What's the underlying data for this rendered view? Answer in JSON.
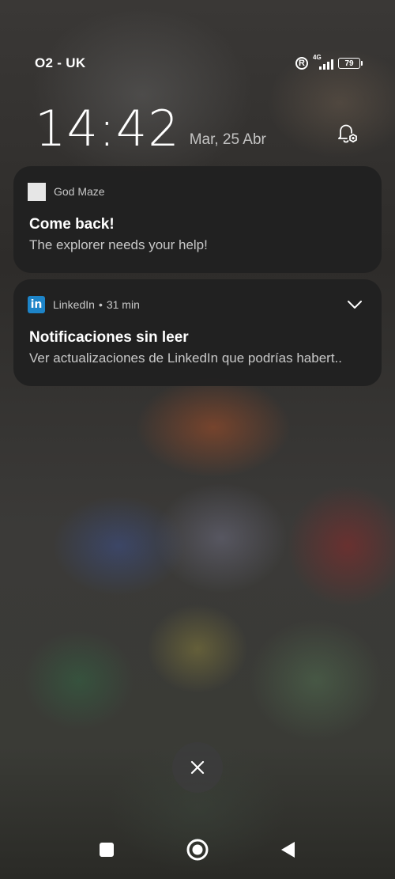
{
  "status_bar": {
    "carrier": "O2 - UK",
    "roaming_letter": "R",
    "network_type": "4G",
    "battery_level": "79",
    "signal_icon": "signal-bars-icon"
  },
  "lockscreen": {
    "time": "14:42",
    "date": "Mar, 25 Abr",
    "bell_icon": "notification-settings-icon"
  },
  "notifications": [
    {
      "app_name": "God Maze",
      "title": "Come back!",
      "body": "The explorer needs your help!",
      "icon": "blank-app-icon"
    },
    {
      "app_name": "LinkedIn",
      "icon_text": "in",
      "time_ago": "31 min",
      "title": "Notificaciones sin leer",
      "body": "Ver actualizaciones de LinkedIn que podrías habert..",
      "icon": "linkedin-icon",
      "brand_color": "#1d84c8"
    }
  ],
  "dismiss_icon": "close-icon",
  "navbar": {
    "recent_icon": "square-icon",
    "home_icon": "circle-icon",
    "back_icon": "triangle-back-icon"
  }
}
